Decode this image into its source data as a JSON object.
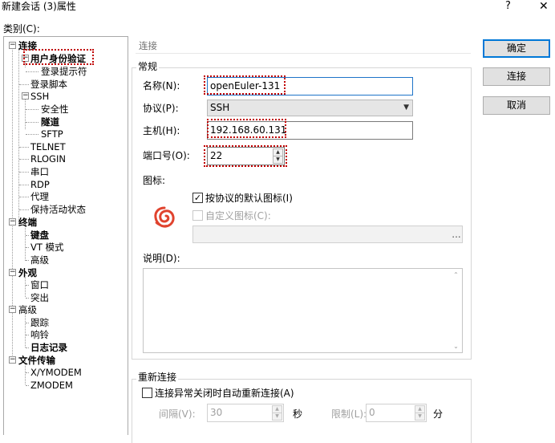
{
  "window": {
    "title": "新建会话 (3)属性",
    "help_label": "?",
    "close_label": "✕"
  },
  "category_label": "类别(C):",
  "tree": [
    {
      "label": "连接",
      "bold": true
    },
    {
      "label": "用户身份验证",
      "bold": true
    },
    {
      "label": "登录提示符",
      "bold": false
    },
    {
      "label": "登录脚本",
      "bold": false
    },
    {
      "label": "SSH",
      "bold": false
    },
    {
      "label": "安全性",
      "bold": false
    },
    {
      "label": "隧道",
      "bold": true
    },
    {
      "label": "SFTP",
      "bold": false
    },
    {
      "label": "TELNET",
      "bold": false
    },
    {
      "label": "RLOGIN",
      "bold": false
    },
    {
      "label": "串口",
      "bold": false
    },
    {
      "label": "RDP",
      "bold": false
    },
    {
      "label": "代理",
      "bold": false
    },
    {
      "label": "保持活动状态",
      "bold": false
    },
    {
      "label": "终端",
      "bold": true
    },
    {
      "label": "键盘",
      "bold": true
    },
    {
      "label": "VT 模式",
      "bold": false
    },
    {
      "label": "高级",
      "bold": false
    },
    {
      "label": "外观",
      "bold": true
    },
    {
      "label": "窗口",
      "bold": false
    },
    {
      "label": "突出",
      "bold": false
    },
    {
      "label": "高级",
      "bold": false
    },
    {
      "label": "跟踪",
      "bold": false
    },
    {
      "label": "响铃",
      "bold": false
    },
    {
      "label": "日志记录",
      "bold": true
    },
    {
      "label": "文件传输",
      "bold": true
    },
    {
      "label": "X/YMODEM",
      "bold": false
    },
    {
      "label": "ZMODEM",
      "bold": false
    }
  ],
  "panel": {
    "header": "连接",
    "general_group": "常规",
    "name_label": "名称(N):",
    "name_value": "openEuler-131",
    "protocol_label": "协议(P):",
    "protocol_value": "SSH",
    "host_label": "主机(H):",
    "host_value": "192.168.60.131",
    "port_label": "端口号(O):",
    "port_value": "22",
    "icon_label": "图标:",
    "default_icon_checkbox": "按协议的默认图标(I)",
    "default_icon_checked": "✓",
    "custom_icon_checkbox": "自定义图标(C):",
    "browse_label": "...",
    "description_label": "说明(D):",
    "reconnect_group": "重新连接",
    "auto_reconnect_checkbox": "连接异常关闭时自动重新连接(A)",
    "interval_label": "间隔(V):",
    "interval_value": "30",
    "seconds_label": "秒",
    "limit_label": "限制(L):",
    "limit_value": "0",
    "minutes_label": "分"
  },
  "buttons": {
    "ok": "确定",
    "connect": "连接",
    "cancel": "取消"
  },
  "colors": {
    "accent": "#0078d7",
    "highlight_dashed": "#c00000",
    "icon_red": "#e0432e"
  }
}
